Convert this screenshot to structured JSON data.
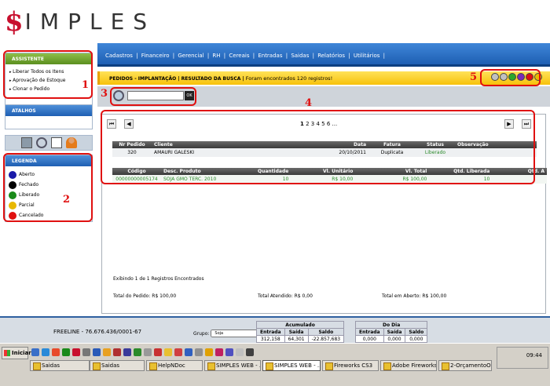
{
  "logo": {
    "dollar": "$",
    "word": "IMPLES"
  },
  "nav": {
    "items": [
      "Cadastros",
      "Financeiro",
      "Gerencial",
      "RH",
      "Cereais",
      "Entradas",
      "Saidas",
      "Relatórios",
      "Utilitários"
    ],
    "sep": "|"
  },
  "assistente": {
    "title": "ASSISTENTE",
    "items": [
      "Liberar Todos os Itens",
      "Aprovação de Estoque",
      "Clonar o Pedido"
    ]
  },
  "atalhos": {
    "title": "ATALHOS"
  },
  "legenda": {
    "title": "LEGENDA",
    "items": [
      {
        "label": "Aberto",
        "color": "#1a1aa8"
      },
      {
        "label": "Fechado",
        "color": "#000000"
      },
      {
        "label": "Liberado",
        "color": "#1a8a1a"
      },
      {
        "label": "Parcial",
        "color": "#e8b800"
      },
      {
        "label": "Cancelado",
        "color": "#e01010"
      }
    ]
  },
  "annotations": [
    "1",
    "2",
    "3",
    "4",
    "5"
  ],
  "status": {
    "breadcrumb": "PEDIDOS - IMPLANTAÇÃO | RESULTADO DA BUSCA |",
    "message": " Foram encontrados 120 registros!"
  },
  "actions": {
    "colors": [
      "#c0c0c0",
      "#c0c0c0",
      "#2aa82a",
      "#7a2ab8",
      "#e01010",
      "#e8b800"
    ]
  },
  "search": {
    "value": "",
    "placeholder": "",
    "ok_label": "OK"
  },
  "pager": {
    "current": "1",
    "others": "2 3 4 5 6 ...",
    "first": "⏮",
    "prev": "◀",
    "next": "▶",
    "last": "⏭"
  },
  "orders": {
    "headers": [
      "Nr Pedido",
      "Cliente",
      "Data",
      "Fatura",
      "Status",
      "Observação"
    ],
    "rows": [
      [
        "320",
        "AMAURI GALESKI",
        "20/10/2011",
        "Duplicata",
        "Liberado",
        ""
      ]
    ]
  },
  "items": {
    "headers": [
      "Código",
      "Desc. Produto",
      "Quantidade",
      "Vl. Unitário",
      "Vl. Total",
      "Qtd. Liberada",
      "Qtd. A"
    ],
    "rows": [
      [
        "00000000005174",
        "SOJA GMO TERC. 2010",
        "10",
        "R$ 10,00",
        "R$ 100,00",
        "10",
        ""
      ]
    ]
  },
  "footer": {
    "showing": "Exibindo 1 de 1 Registros Encontrados",
    "total_pedido": "Total do Pedido: R$ 100,00",
    "total_atendido": "Total Atendido: R$ 0,00",
    "total_aberto": "Total em Aberto: R$ 100,00"
  },
  "company": "FREELINE - 76.676.436/0001-67",
  "grupo": {
    "label": "Grupo:",
    "value": "Soja"
  },
  "acumulado": {
    "title": "Acumulado",
    "headers": [
      "Entrada",
      "Saída",
      "Saldo"
    ],
    "values": [
      "312,158",
      "64,301",
      "-22.857,683"
    ]
  },
  "dodia": {
    "title": "Do Dia",
    "headers": [
      "Entrada",
      "Saída",
      "Saldo"
    ],
    "values": [
      "0,000",
      "0,000",
      "0,000"
    ]
  },
  "taskbar": {
    "start": "Iniciar",
    "tasks": [
      "Saidas",
      "Saidas",
      "HelpNDoc",
      "SIMPLES WEB - ...",
      "SIMPLES WEB - ...",
      "Fireworks CS3",
      "Adobe Fireworks...",
      "2-OrçamentoOK..."
    ],
    "clock": "09:44",
    "quick_colors": [
      "#3a6fc8",
      "#2a8ad8",
      "#e84a2a",
      "#1a8a1a",
      "#c8102e",
      "#777777",
      "#2a5ab8",
      "#e8a020",
      "#b03030",
      "#3a3a9a",
      "#2a8a2a",
      "#999999",
      "#c83030",
      "#e8c030",
      "#d04040",
      "#3060c0",
      "#909090",
      "#e0a000",
      "#c02060",
      "#5050c0",
      "#c0c0c0",
      "#404040"
    ]
  }
}
